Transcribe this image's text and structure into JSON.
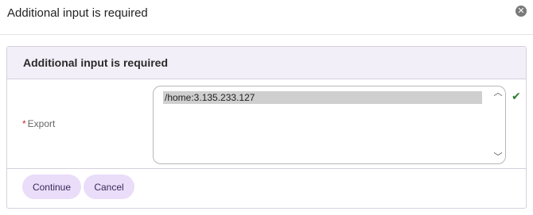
{
  "dialog": {
    "title": "Additional input is required",
    "close_icon": "close-icon"
  },
  "panel": {
    "title": "Additional input is required",
    "field": {
      "required_marker": "*",
      "label": "Export",
      "value": "/home:3.135.233.127",
      "status_icon": "check-icon"
    },
    "buttons": {
      "continue_label": "Continue",
      "cancel_label": "Cancel"
    }
  },
  "colors": {
    "panel_header_bg": "#f3eff8",
    "button_bg": "#e9ddf9",
    "required": "#c62828",
    "valid_check": "#2e7d32"
  }
}
